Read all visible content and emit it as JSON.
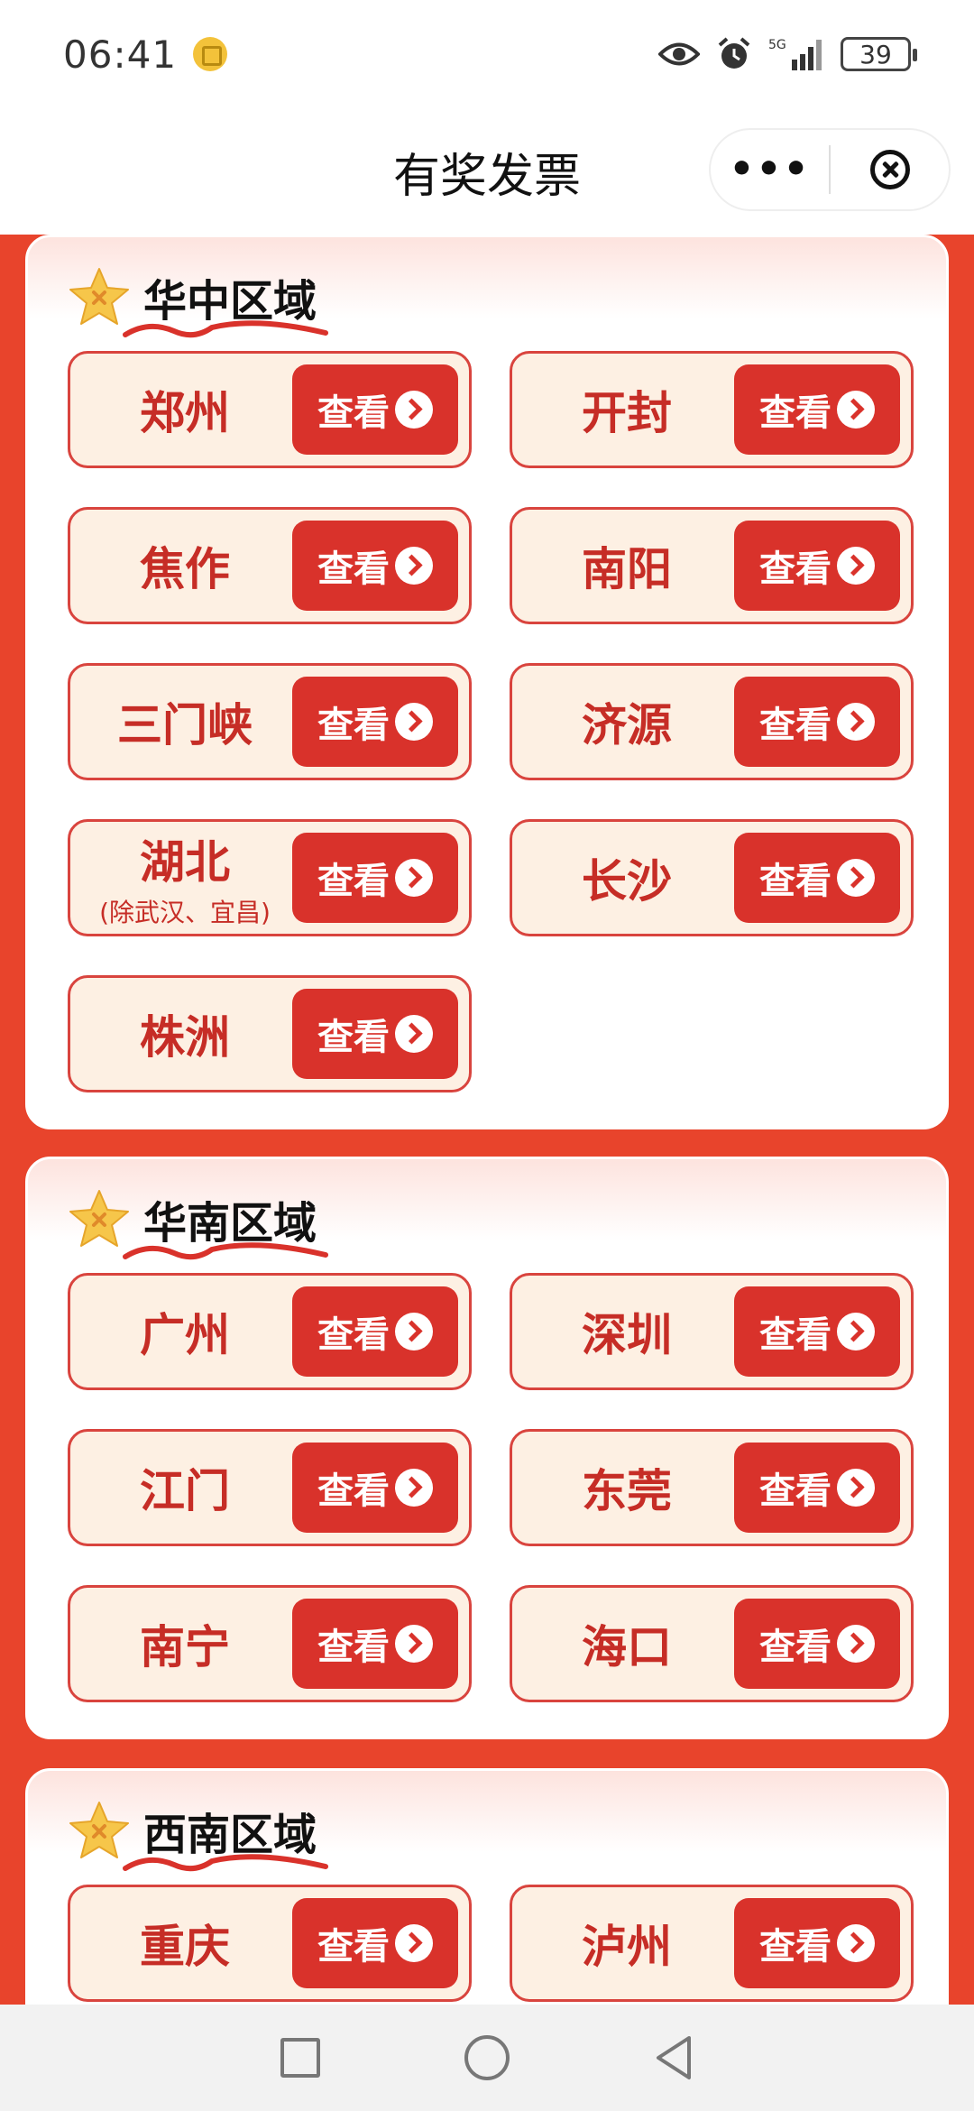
{
  "status_bar": {
    "time": "06:41",
    "network": "5G",
    "battery": "39"
  },
  "header": {
    "title": "有奖发票"
  },
  "regions": [
    {
      "title": "华中区域",
      "cities": [
        {
          "name": "郑州",
          "button": "查看"
        },
        {
          "name": "开封",
          "button": "查看"
        },
        {
          "name": "焦作",
          "button": "查看"
        },
        {
          "name": "南阳",
          "button": "查看"
        },
        {
          "name": "三门峡",
          "button": "查看"
        },
        {
          "name": "济源",
          "button": "查看"
        },
        {
          "name": "湖北",
          "sub": "(除武汉、宜昌)",
          "button": "查看"
        },
        {
          "name": "长沙",
          "button": "查看"
        },
        {
          "name": "株洲",
          "button": "查看"
        }
      ]
    },
    {
      "title": "华南区域",
      "cities": [
        {
          "name": "广州",
          "button": "查看"
        },
        {
          "name": "深圳",
          "button": "查看"
        },
        {
          "name": "江门",
          "button": "查看"
        },
        {
          "name": "东莞",
          "button": "查看"
        },
        {
          "name": "南宁",
          "button": "查看"
        },
        {
          "name": "海口",
          "button": "查看"
        }
      ]
    },
    {
      "title": "西南区域",
      "cities": [
        {
          "name": "重庆",
          "button": "查看"
        },
        {
          "name": "泸州",
          "button": "查看"
        }
      ]
    }
  ],
  "colors": {
    "background": "#e8442c",
    "button": "#d9322b",
    "card": "#fdf0e3",
    "text_red": "#c62d26"
  }
}
